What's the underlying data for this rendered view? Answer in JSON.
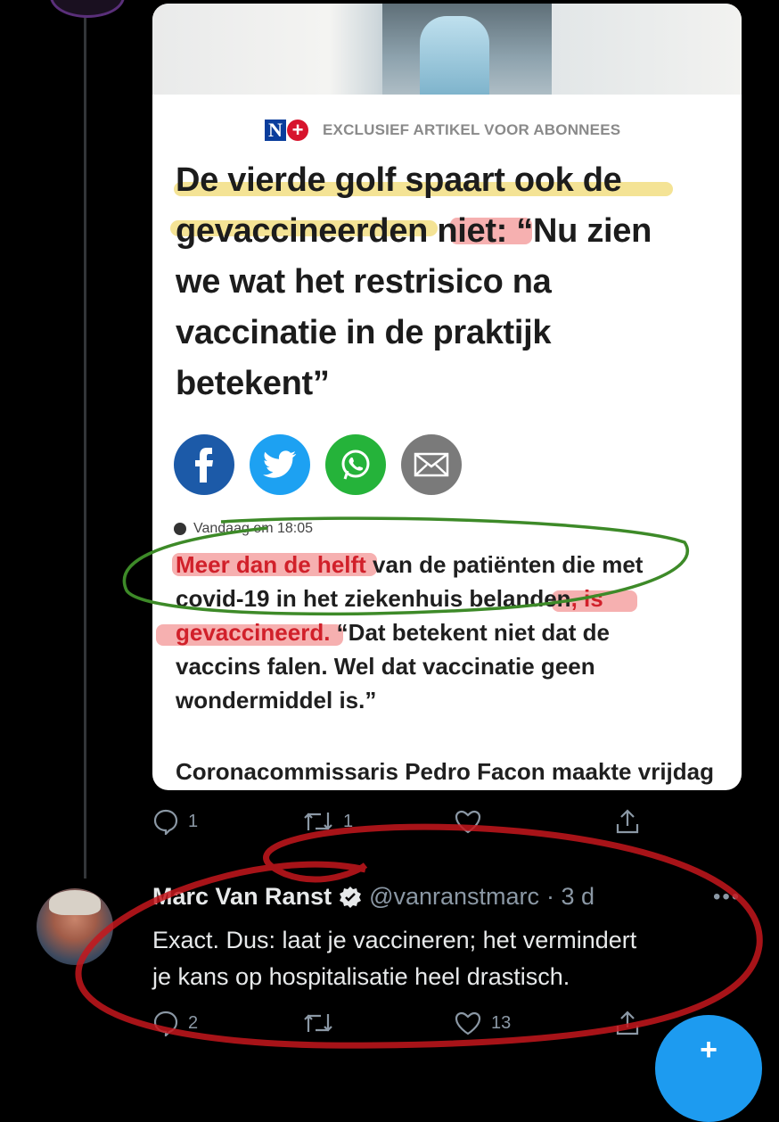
{
  "article": {
    "badge_text": "EXCLUSIEF ARTIKEL VOOR ABONNEES",
    "logo_letter": "N",
    "headline_line1": "De vierde golf spaart ook de",
    "headline_line2a": "gevaccineerden ",
    "headline_line2b": "niet:",
    "headline_line2c": " “Nu zien",
    "headline_line3": "we wat het restrisico na",
    "headline_line4": "vaccinatie in de praktijk",
    "headline_line5": "betekent”",
    "timestamp": "Vandaag om 18:05",
    "lead_red1": "Meer dan de helft",
    "lead_text1": " van de patiënten die met",
    "lead_text2": "covid-19 in het ziekenhuis belanden",
    "lead_red2": ", is",
    "lead_red3": "gevaccineerd.",
    "lead_text3": " “Dat betekent niet dat de",
    "lead_text4": "vaccins falen. Wel dat vaccinatie geen",
    "lead_text5": "wondermiddel is.”",
    "more_text": "Coronacommissaris Pedro Facon maakte vrijdag"
  },
  "first_tweet_actions": {
    "replies": "1",
    "retweets": "1",
    "likes": ""
  },
  "reply_tweet": {
    "name": "Marc Van Ranst",
    "handle": "@vanranstmarc",
    "time": "· 3 d",
    "text_line1": "Exact. Dus: laat je vaccineren; het vermindert",
    "text_line2": "je kans op hospitalisatie heel drastisch.",
    "replies": "2",
    "retweets": "",
    "likes": "13"
  },
  "fab_label": "+",
  "colors": {
    "accent": "#1d9bf0",
    "facebook": "#1c5aa8",
    "twitter": "#1da1f2",
    "whatsapp": "#25b33a",
    "mail": "#7a7a7a"
  }
}
